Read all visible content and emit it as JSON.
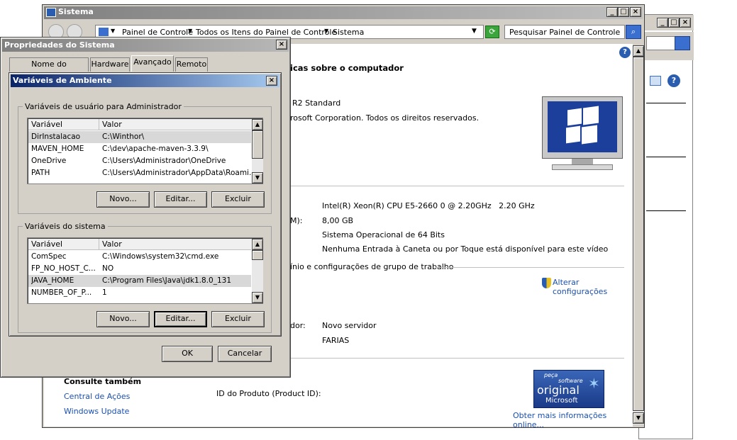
{
  "system_window": {
    "title": "Sistema",
    "breadcrumb": [
      "Painel de Controle",
      "Todos os Itens do Painel de Controle",
      "Sistema"
    ],
    "search_placeholder": "Pesquisar Painel de Controle",
    "heading_fragment": "icas sobre o computador",
    "edition_fragment": "R2 Standard",
    "copyright_fragment": "rosoft Corporation. Todos os direitos reservados.",
    "cpu": "Intel(R) Xeon(R) CPU E5-2660 0 @ 2.20GHz   2.20 GHz",
    "ram_label_fragment": "M):",
    "ram": "8,00 GB",
    "system_type": "Sistema Operacional de 64 Bits",
    "pen_touch": "Nenhuma Entrada à Caneta ou por Toque está disponível para este vídeo",
    "domain_section": "ínio e configurações de grupo de trabalho",
    "change_settings_line1": "Alterar",
    "change_settings_line2": "configurações",
    "description_label_fragment": "dor:",
    "description_value": "Novo servidor",
    "workgroup_value": "FARIAS",
    "see_also_fragment": "Consulte também",
    "see_also_links": [
      "Central de Ações",
      "Windows Update"
    ],
    "product_id_label": "ID do Produto (Product ID):",
    "genuine_text": [
      "peça",
      "software",
      "original",
      "Microsoft"
    ],
    "more_info_link": "Obter mais informações online..."
  },
  "sys_props": {
    "title": "Propriedades do Sistema",
    "tabs": [
      "Nome do computador",
      "Hardware",
      "Avançado",
      "Remoto"
    ],
    "active_tab": "Avançado",
    "ok": "OK",
    "cancel": "Cancelar"
  },
  "env_dialog": {
    "title": "Variáveis de Ambiente",
    "user_group": "Variáveis de usuário para Administrador",
    "system_group": "Variáveis do sistema",
    "col_var": "Variável",
    "col_val": "Valor",
    "user_vars": [
      {
        "name": "DirInstalacao",
        "value": "C:\\Winthor\\"
      },
      {
        "name": "MAVEN_HOME",
        "value": "C:\\dev\\apache-maven-3.3.9\\"
      },
      {
        "name": "OneDrive",
        "value": "C:\\Users\\Administrador\\OneDrive"
      },
      {
        "name": "PATH",
        "value": "C:\\Users\\Administrador\\AppData\\Roami..."
      }
    ],
    "system_vars": [
      {
        "name": "ComSpec",
        "value": "C:\\Windows\\system32\\cmd.exe"
      },
      {
        "name": "FP_NO_HOST_C...",
        "value": "NO"
      },
      {
        "name": "JAVA_HOME",
        "value": "C:\\Program Files\\Java\\jdk1.8.0_131"
      },
      {
        "name": "NUMBER_OF_P...",
        "value": "1"
      }
    ],
    "new": "Novo...",
    "edit": "Editar...",
    "delete": "Excluir"
  },
  "colors": {
    "title_active": "#0a246a",
    "title_active_end": "#a6caf0",
    "title_inactive": "#808080",
    "face": "#d4d0c8",
    "link": "#1a4fb0",
    "selected_row": "#d8d8d8"
  }
}
